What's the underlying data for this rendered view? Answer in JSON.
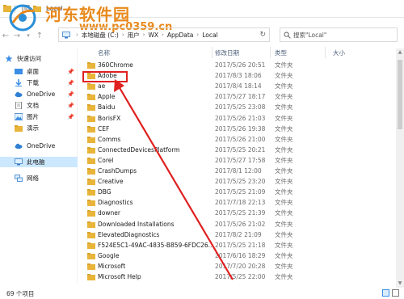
{
  "window": {
    "title": "Local"
  },
  "watermark": {
    "site_name": "河东软件园",
    "site_url": "www.pc0359.cn"
  },
  "address_bar": {
    "breadcrumbs": [
      "本地磁盘 (C:)",
      "用户",
      "WX",
      "AppData",
      "Local"
    ],
    "search_placeholder": "搜索\"Local\""
  },
  "sidebar": {
    "items": [
      {
        "label": "快速访问",
        "icon": "star-icon",
        "pinned": false
      },
      {
        "label": "桌面",
        "icon": "desktop-icon",
        "pinned": true
      },
      {
        "label": "下载",
        "icon": "download-icon",
        "pinned": true
      },
      {
        "label": "OneDrive",
        "icon": "cloud-icon",
        "pinned": true
      },
      {
        "label": "文档",
        "icon": "document-icon",
        "pinned": true
      },
      {
        "label": "图片",
        "icon": "picture-icon",
        "pinned": true
      },
      {
        "label": "演示",
        "icon": "folder-icon",
        "pinned": false
      },
      {
        "label": "OneDrive",
        "icon": "cloud-icon",
        "pinned": false
      },
      {
        "label": "此电脑",
        "icon": "computer-icon",
        "pinned": false
      },
      {
        "label": "网络",
        "icon": "network-icon",
        "pinned": false
      }
    ],
    "selected_index": 8
  },
  "columns": {
    "name": "名称",
    "date": "修改日期",
    "type": "类型",
    "size": "大小"
  },
  "files": [
    {
      "name": "360Chrome",
      "date": "2017/5/26 20:51",
      "type": "文件夹"
    },
    {
      "name": "Adobe",
      "date": "2017/8/3 18:06",
      "type": "文件夹"
    },
    {
      "name": "ae",
      "date": "2017/8/4 18:14",
      "type": "文件夹"
    },
    {
      "name": "Apple",
      "date": "2017/5/27 18:17",
      "type": "文件夹"
    },
    {
      "name": "Baidu",
      "date": "2017/5/25 23:08",
      "type": "文件夹"
    },
    {
      "name": "BorisFX",
      "date": "2017/5/26 21:03",
      "type": "文件夹"
    },
    {
      "name": "CEF",
      "date": "2017/5/26 19:38",
      "type": "文件夹"
    },
    {
      "name": "Comms",
      "date": "2017/5/26 21:00",
      "type": "文件夹"
    },
    {
      "name": "ConnectedDevicesPlatform",
      "date": "2017/5/25 20:21",
      "type": "文件夹"
    },
    {
      "name": "Corel",
      "date": "2017/5/27 17:58",
      "type": "文件夹"
    },
    {
      "name": "CrashDumps",
      "date": "2017/8/1 12:00",
      "type": "文件夹"
    },
    {
      "name": "Creative",
      "date": "2017/5/25 23:20",
      "type": "文件夹"
    },
    {
      "name": "DBG",
      "date": "2017/5/25 21:09",
      "type": "文件夹"
    },
    {
      "name": "Diagnostics",
      "date": "2017/7/18 22:13",
      "type": "文件夹"
    },
    {
      "name": "downer",
      "date": "2017/5/25 21:39",
      "type": "文件夹"
    },
    {
      "name": "Downloaded Installations",
      "date": "2017/5/26 21:02",
      "type": "文件夹"
    },
    {
      "name": "ElevatedDiagnostics",
      "date": "2017/8/2 21:09",
      "type": "文件夹"
    },
    {
      "name": "F524E5C1-49AC-4835-B859-6FDC26...",
      "date": "2017/5/25 21:18",
      "type": "文件夹"
    },
    {
      "name": "Google",
      "date": "2017/6/16 18:29",
      "type": "文件夹"
    },
    {
      "name": "Microsoft",
      "date": "2017/7/20 20:28",
      "type": "文件夹"
    },
    {
      "name": "Microsoft Help",
      "date": "2017/5/25 22:00",
      "type": "文件夹"
    }
  ],
  "status": {
    "item_count": "69 个项目"
  },
  "colors": {
    "folder": "#e8b53a",
    "selection": "#cce8ff",
    "annotation": "#e02020",
    "watermark": "#e8891c"
  }
}
